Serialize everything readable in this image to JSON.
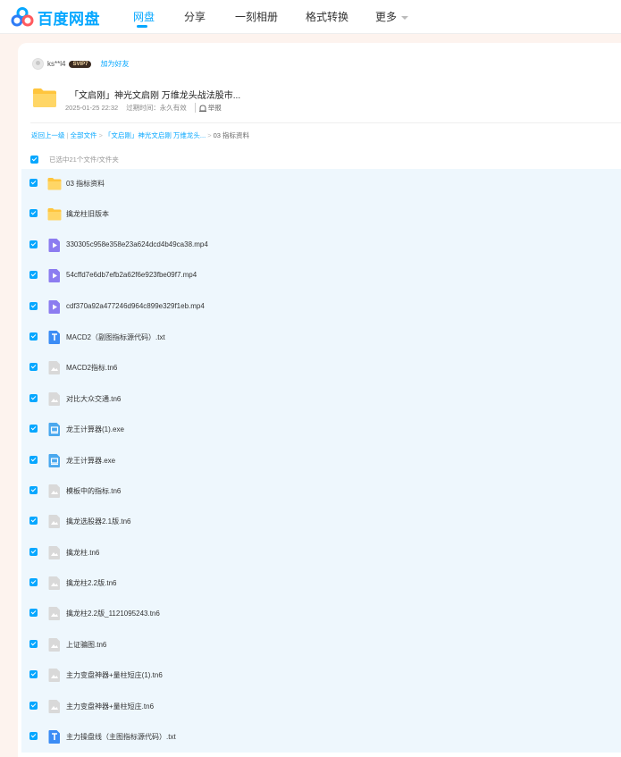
{
  "header": {
    "logo_text": "百度网盘",
    "nav": [
      {
        "label": "网盘",
        "active": true
      },
      {
        "label": "分享",
        "active": false
      },
      {
        "label": "一刻相册",
        "active": false
      },
      {
        "label": "格式转换",
        "active": false
      },
      {
        "label": "更多",
        "active": false
      }
    ]
  },
  "share": {
    "sharer_name": "ks**l4",
    "vip_badge": "SVIP7",
    "add_friend": "加为好友",
    "title": "「文启刚」神光文启刚 万维龙头战法股市...",
    "date": "2025-01-25 22:32",
    "expiry": "过期时间：永久有效",
    "report": "举报"
  },
  "breadcrumb": {
    "back": "返回上一级",
    "all_files": "全部文件",
    "folder": "「文启刚」神光文启刚 万维龙头...",
    "current": "03 指标资料"
  },
  "selection": {
    "text": "已选中21个文件/文件夹"
  },
  "files": [
    {
      "name": "03 指标资料",
      "icon": "folder-icon"
    },
    {
      "name": "擒龙柱旧版本",
      "icon": "folder-icon"
    },
    {
      "name": "330305c958e358e23a624dcd4b49ca38.mp4",
      "icon": "video-icon"
    },
    {
      "name": "54cffd7e6db7efb2a62f6e923fbe09f7.mp4",
      "icon": "video-icon"
    },
    {
      "name": "cdf370a92a477246d964c899e329f1eb.mp4",
      "icon": "video-icon"
    },
    {
      "name": "MACD2（副图指标源代码）.txt",
      "icon": "txt-icon"
    },
    {
      "name": "MACD2指标.tn6",
      "icon": "unknown-file-icon"
    },
    {
      "name": "对比大众交通.tn6",
      "icon": "unknown-file-icon"
    },
    {
      "name": "龙王计算器(1).exe",
      "icon": "exe-icon"
    },
    {
      "name": "龙王计算器.exe",
      "icon": "exe-icon"
    },
    {
      "name": "模板中的指标.tn6",
      "icon": "unknown-file-icon"
    },
    {
      "name": "擒龙选股器2.1版.tn6",
      "icon": "unknown-file-icon"
    },
    {
      "name": "擒龙柱.tn6",
      "icon": "unknown-file-icon"
    },
    {
      "name": "擒龙柱2.2版.tn6",
      "icon": "unknown-file-icon"
    },
    {
      "name": "擒龙柱2.2版_1121095243.tn6",
      "icon": "unknown-file-icon"
    },
    {
      "name": "上证骗图.tn6",
      "icon": "unknown-file-icon"
    },
    {
      "name": "主力变盘神器+量柱短庄(1).tn6",
      "icon": "unknown-file-icon"
    },
    {
      "name": "主力变盘神器+量柱短庄.tn6",
      "icon": "unknown-file-icon"
    },
    {
      "name": "主力操盘线（主图指标源代码）.txt",
      "icon": "txt-icon"
    }
  ],
  "colors": {
    "accent": "#06a7ff",
    "folder": "#ffc53d",
    "video": "#8c7cf0",
    "txt": "#3b8cf5",
    "exe": "#4aa8ee",
    "unknown": "#d9d9d9"
  }
}
